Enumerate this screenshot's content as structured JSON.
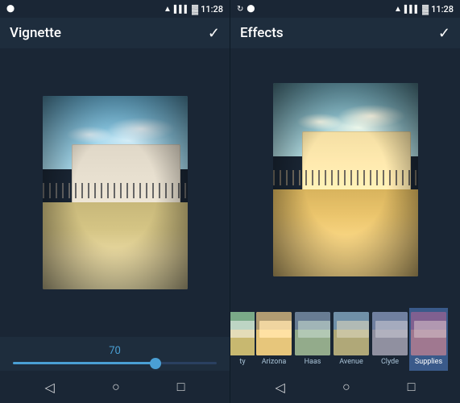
{
  "panels": [
    {
      "id": "vignette",
      "statusBar": {
        "leftIcons": [
          "location-dot"
        ],
        "rightIcons": [
          "wifi",
          "signal",
          "battery"
        ],
        "time": "11:28"
      },
      "title": "Vignette",
      "checkmark": "✓",
      "sliderValue": "70",
      "sliderPercent": 70,
      "navButtons": [
        "◁",
        "○",
        "□"
      ]
    },
    {
      "id": "effects",
      "statusBar": {
        "leftIcons": [
          "refresh",
          "location-dot"
        ],
        "rightIcons": [
          "wifi",
          "signal",
          "battery"
        ],
        "time": "11:28"
      },
      "title": "Effects",
      "checkmark": "✓",
      "effects": [
        {
          "id": "partly-visible",
          "label": "ty",
          "active": false
        },
        {
          "id": "arizona",
          "label": "Arizona",
          "active": false
        },
        {
          "id": "haas",
          "label": "Haas",
          "active": false
        },
        {
          "id": "avenue",
          "label": "Avenue",
          "active": false
        },
        {
          "id": "clyde",
          "label": "Clyde",
          "active": false
        },
        {
          "id": "supplies",
          "label": "Supplies",
          "active": true
        }
      ],
      "navButtons": [
        "◁",
        "○",
        "□"
      ]
    }
  ]
}
